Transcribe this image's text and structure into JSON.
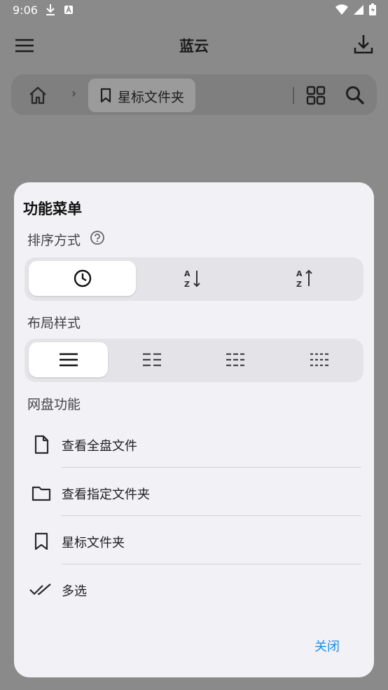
{
  "status_bar": {
    "time": "9:06"
  },
  "app_bar": {
    "title": "蓝云"
  },
  "breadcrumb": {
    "separator": "›",
    "current": "星标文件夹"
  },
  "sheet": {
    "title": "功能菜单",
    "sort": {
      "label": "排序方式",
      "options": [
        "clock-icon",
        "sort-az-down-icon",
        "sort-za-up-icon"
      ],
      "selected": 0
    },
    "layout": {
      "label": "布局样式",
      "options": [
        "list-1col-icon",
        "list-2col-icon",
        "list-3col-icon",
        "list-4col-icon"
      ],
      "selected": 0
    },
    "drive": {
      "label": "网盘功能",
      "items": [
        {
          "label": "查看全盘文件",
          "icon": "file-icon"
        },
        {
          "label": "查看指定文件夹",
          "icon": "folder-icon"
        },
        {
          "label": "星标文件夹",
          "icon": "bookmark-icon"
        },
        {
          "label": "多选",
          "icon": "double-check-icon"
        }
      ]
    },
    "close_label": "关闭"
  },
  "colors": {
    "accent": "#1e8ee6",
    "scrim": "#8a8a8a",
    "sheet": "#f2f1f6"
  }
}
